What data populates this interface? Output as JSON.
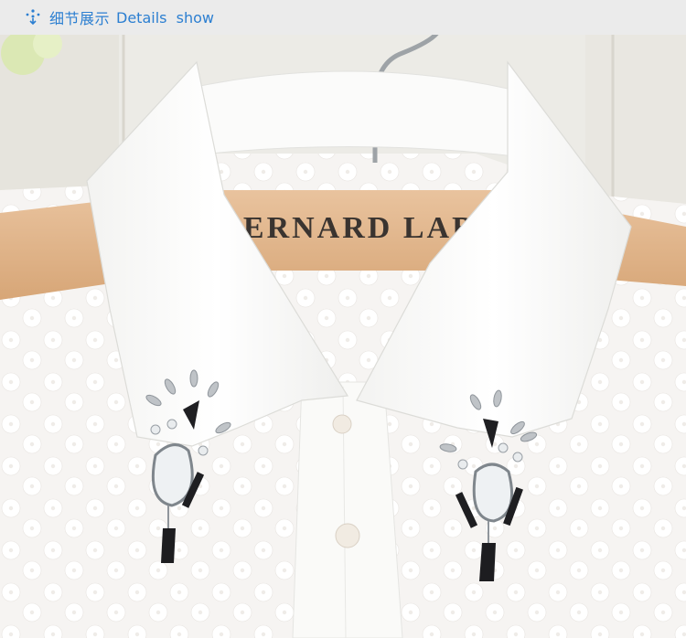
{
  "header": {
    "icon": "sparkle-arrow-icon",
    "title_cn": "细节展示",
    "title_en": "Details  show",
    "accent_color": "#2c7fd1"
  },
  "photo": {
    "hanger_text": "BERNARD LAB"
  }
}
